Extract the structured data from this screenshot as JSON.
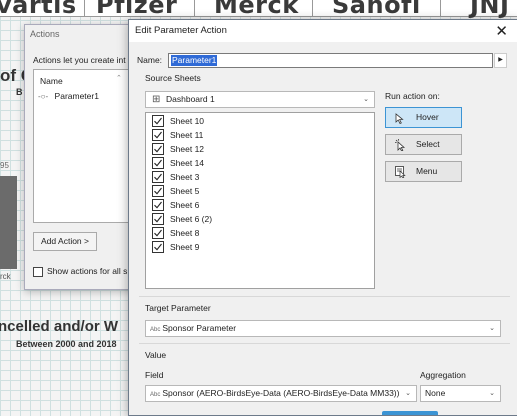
{
  "background": {
    "companies": [
      "vartis",
      "Pfizer",
      "Merck",
      "Sanofi",
      "JNJ"
    ],
    "fragments": {
      "title_left": "of C",
      "title_left_sub": "B",
      "axis_num": "95",
      "axis_cat": "rck",
      "chart_title": "ncelled and/or W",
      "chart_subtitle": "Between 2000 and 2018"
    }
  },
  "actions_dialog": {
    "title": "Actions",
    "description": "Actions let you create int",
    "list_header": "Name",
    "list_items": [
      "Parameter1"
    ],
    "add_button": "Add Action >",
    "show_actions_label": "Show actions for all s"
  },
  "edit_dialog": {
    "title": "Edit Parameter Action",
    "name_label": "Name:",
    "name_value": "Parameter1",
    "source_sheets_label": "Source Sheets",
    "source_dashboard": "Dashboard 1",
    "sheets": [
      {
        "label": "Sheet 10",
        "checked": true
      },
      {
        "label": "Sheet 11",
        "checked": true
      },
      {
        "label": "Sheet 12",
        "checked": true
      },
      {
        "label": "Sheet 14",
        "checked": true
      },
      {
        "label": "Sheet 3",
        "checked": true
      },
      {
        "label": "Sheet 5",
        "checked": true
      },
      {
        "label": "Sheet 6",
        "checked": true
      },
      {
        "label": "Sheet 6 (2)",
        "checked": true
      },
      {
        "label": "Sheet 8",
        "checked": true
      },
      {
        "label": "Sheet 9",
        "checked": true
      }
    ],
    "run_action_label": "Run action on:",
    "run_options": [
      "Hover",
      "Select",
      "Menu"
    ],
    "run_selected": "Hover",
    "target_parameter_label": "Target Parameter",
    "target_parameter_value": "Sponsor Parameter",
    "value_label": "Value",
    "field_label": "Field",
    "field_value": "Sponsor (AERO-BirdsEye-Data (AERO-BirdsEye-Data MM33))",
    "aggregation_label": "Aggregation",
    "aggregation_value": "None",
    "abc_badge": "Abc"
  },
  "colors": {
    "selection": "#2f6ad6",
    "active_button_bg": "#cde6f7",
    "active_button_border": "#3c94d4"
  }
}
